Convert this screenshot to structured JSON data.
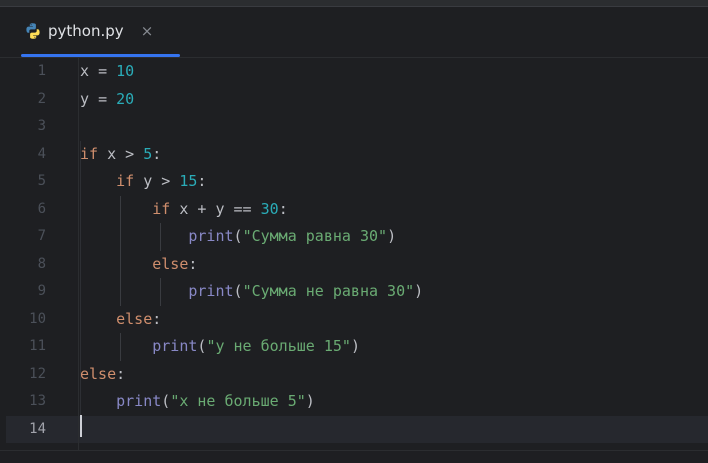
{
  "tab": {
    "title": "python.py",
    "close_glyph": "×",
    "icon": "python-file-icon",
    "accent": "#3574f0"
  },
  "editor": {
    "current_line": 14,
    "line_numbers": [
      "1",
      "2",
      "3",
      "4",
      "5",
      "6",
      "7",
      "8",
      "9",
      "10",
      "11",
      "12",
      "13",
      "14"
    ],
    "lines": [
      [
        {
          "t": "x ",
          "c": "op"
        },
        {
          "t": "=",
          "c": "op"
        },
        {
          "t": " ",
          "c": "op"
        },
        {
          "t": "10",
          "c": "num"
        }
      ],
      [
        {
          "t": "y ",
          "c": "op"
        },
        {
          "t": "=",
          "c": "op"
        },
        {
          "t": " ",
          "c": "op"
        },
        {
          "t": "20",
          "c": "num"
        }
      ],
      [],
      [
        {
          "t": "if",
          "c": "kw"
        },
        {
          "t": " x > ",
          "c": "op"
        },
        {
          "t": "5",
          "c": "num"
        },
        {
          "t": ":",
          "c": "op"
        }
      ],
      [
        {
          "t": "    ",
          "c": "op"
        },
        {
          "t": "if",
          "c": "kw"
        },
        {
          "t": " y > ",
          "c": "op"
        },
        {
          "t": "15",
          "c": "num"
        },
        {
          "t": ":",
          "c": "op"
        }
      ],
      [
        {
          "t": "        ",
          "c": "op"
        },
        {
          "t": "if",
          "c": "kw"
        },
        {
          "t": " x + y == ",
          "c": "op"
        },
        {
          "t": "30",
          "c": "num"
        },
        {
          "t": ":",
          "c": "op"
        }
      ],
      [
        {
          "t": "            ",
          "c": "op"
        },
        {
          "t": "print",
          "c": "fn"
        },
        {
          "t": "(",
          "c": "op"
        },
        {
          "t": "\"Сумма равна 30\"",
          "c": "str"
        },
        {
          "t": ")",
          "c": "op"
        }
      ],
      [
        {
          "t": "        ",
          "c": "op"
        },
        {
          "t": "else",
          "c": "kw"
        },
        {
          "t": ":",
          "c": "op"
        }
      ],
      [
        {
          "t": "            ",
          "c": "op"
        },
        {
          "t": "print",
          "c": "fn"
        },
        {
          "t": "(",
          "c": "op"
        },
        {
          "t": "\"Сумма не равна 30\"",
          "c": "str"
        },
        {
          "t": ")",
          "c": "op"
        }
      ],
      [
        {
          "t": "    ",
          "c": "op"
        },
        {
          "t": "else",
          "c": "kw"
        },
        {
          "t": ":",
          "c": "op"
        }
      ],
      [
        {
          "t": "        ",
          "c": "op"
        },
        {
          "t": "print",
          "c": "fn"
        },
        {
          "t": "(",
          "c": "op"
        },
        {
          "t": "\"y не больше 15\"",
          "c": "str"
        },
        {
          "t": ")",
          "c": "op"
        }
      ],
      [
        {
          "t": "else",
          "c": "kw"
        },
        {
          "t": ":",
          "c": "op"
        }
      ],
      [
        {
          "t": "    ",
          "c": "op"
        },
        {
          "t": "print",
          "c": "fn"
        },
        {
          "t": "(",
          "c": "op"
        },
        {
          "t": "\"x не больше 5\"",
          "c": "str"
        },
        {
          "t": ")",
          "c": "op"
        }
      ],
      []
    ]
  },
  "colors": {
    "background": "#1e1f22",
    "keyword": "#cf8e6d",
    "number": "#2aacb8",
    "string": "#6aab73",
    "builtin": "#8888c6",
    "text": "#bcbec4"
  }
}
